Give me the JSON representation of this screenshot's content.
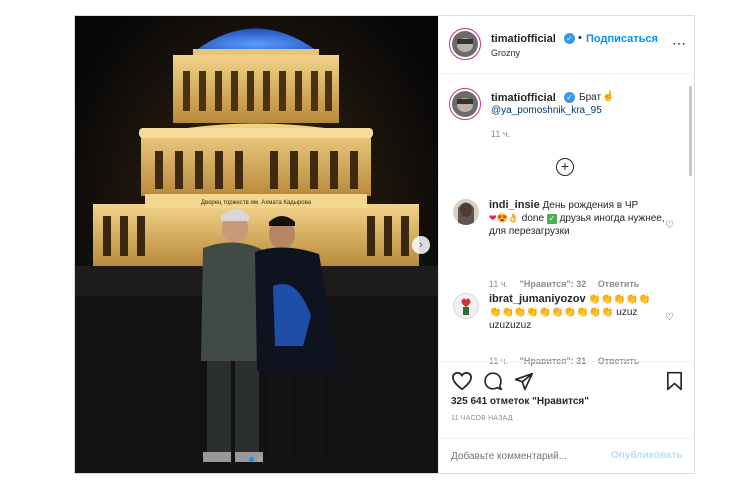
{
  "post": {
    "header": {
      "username": "timatiofficial",
      "follow_label": "Подписаться",
      "location": "Grozny",
      "dot": "•"
    },
    "caption": {
      "username": "timatiofficial",
      "text": "Брат",
      "mention": "@ya_pomoshnik_kra_95",
      "time": "11 ч."
    },
    "comments": [
      {
        "username": "indi_insie",
        "text_part1": "День рождения в ЧР",
        "text_part2": "done",
        "text_part3": "друзья иногда нужнее, для перезагрузки",
        "time": "11 ч.",
        "likes": "\"Нравится\": 32",
        "reply": "Ответить"
      },
      {
        "username": "ibrat_jumaniyozov",
        "text_tail1": "uzuz",
        "text_tail2": "uzuzuzuz",
        "time": "11 ч.",
        "likes": "\"Нравится\": 31",
        "reply": "Ответить"
      }
    ],
    "likes_count": "325 641 отметок \"Нравится\"",
    "posted_ago": "11 ЧАСОВ НАЗАД",
    "comment_input": {
      "placeholder": "Добавьте комментарий...",
      "publish_label": "Опубликовать"
    },
    "photo": {
      "building_sign": "Дворец торжеств им. Ахмата Кадырова"
    },
    "colors": {
      "accent": "#0095f6",
      "publish_disabled": "#b2dffc",
      "verified": "#3897f0",
      "dome": "#2f6bd6"
    }
  }
}
